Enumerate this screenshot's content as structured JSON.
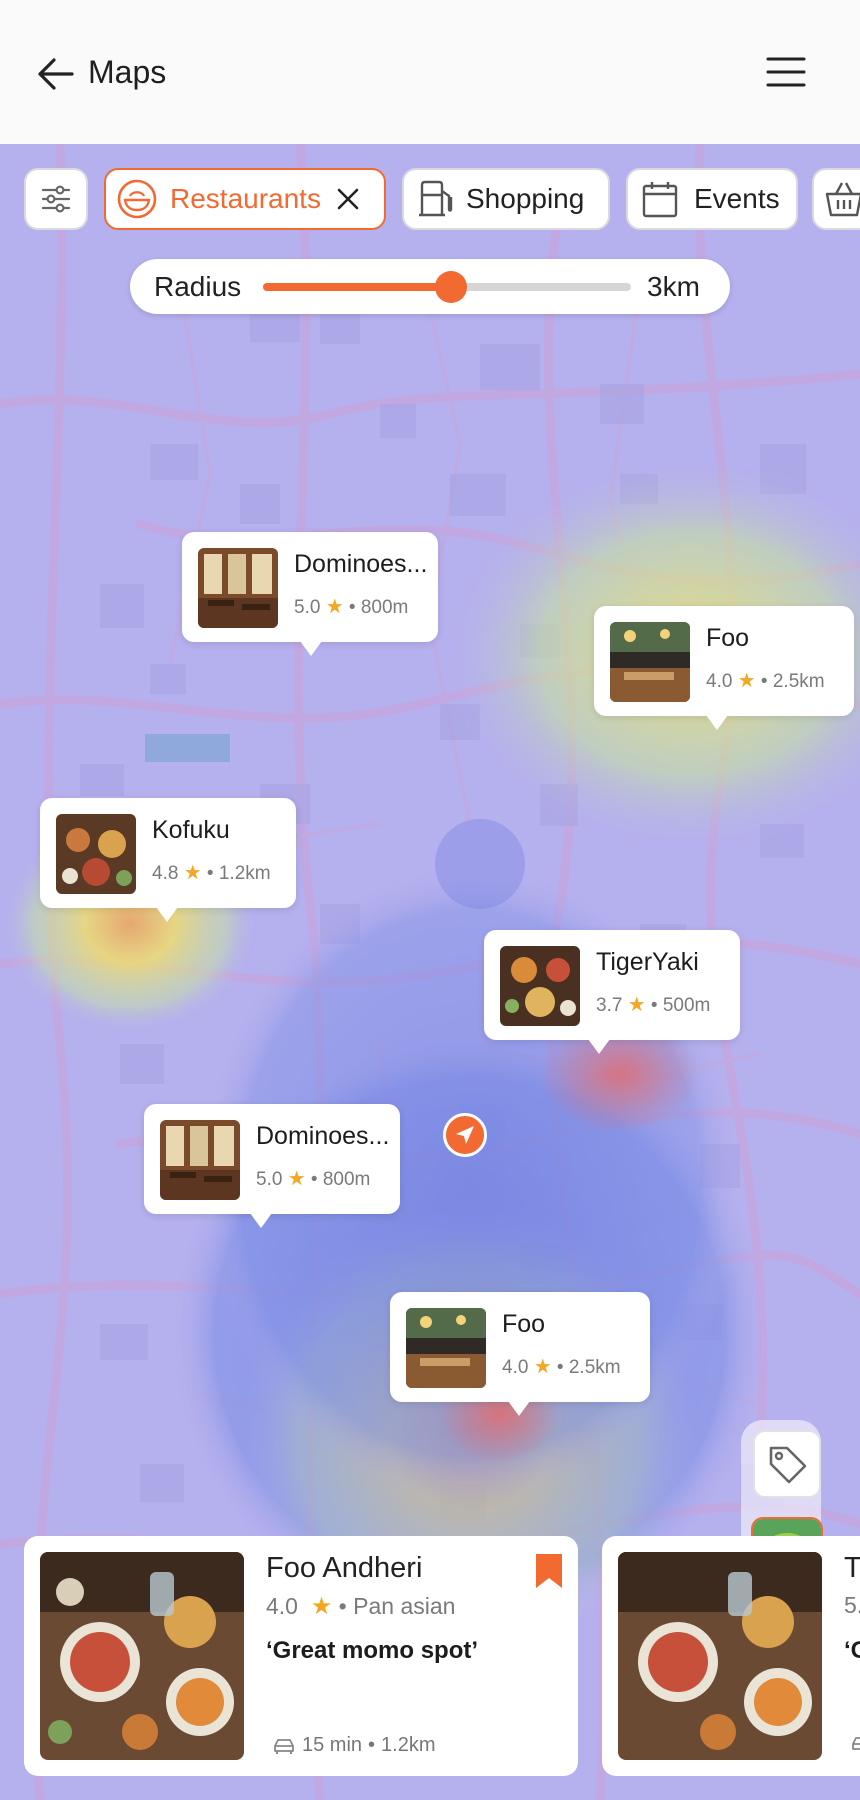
{
  "header": {
    "title": "Maps",
    "back_icon": "arrow-left-icon",
    "menu_icon": "hamburger-menu-icon"
  },
  "filters": {
    "settings_icon": "sliders-icon",
    "chips": [
      {
        "label": "Restaurants",
        "icon": "food-bowl-icon",
        "active": true,
        "close_icon": "close-icon"
      },
      {
        "label": "Shopping",
        "icon": "gas-pump-icon",
        "active": false
      },
      {
        "label": "Events",
        "icon": "calendar-icon",
        "active": false
      },
      {
        "label": "",
        "icon": "basket-icon",
        "active": false
      }
    ]
  },
  "radius": {
    "label": "Radius",
    "value": "3km",
    "fraction": 0.51
  },
  "markers": [
    {
      "name": "Dominoes...",
      "rating": "5.0",
      "distance": "800m"
    },
    {
      "name": "Foo",
      "rating": "4.0",
      "distance": "2.5km"
    },
    {
      "name": "Kofuku",
      "rating": "4.8",
      "distance": "1.2km"
    },
    {
      "name": "TigerYaki",
      "rating": "3.7",
      "distance": "500m"
    },
    {
      "name": "Dominoes...",
      "rating": "5.0",
      "distance": "800m"
    },
    {
      "name": "Foo",
      "rating": "4.0",
      "distance": "2.5km"
    }
  ],
  "separator": "•",
  "star": "★",
  "cards": [
    {
      "name": "Foo Andheri",
      "rating": "4.0",
      "cuisine": "Pan asian",
      "quote": "‘Great momo spot’",
      "time": "15 min",
      "distance": "1.2km"
    },
    {
      "name": "T",
      "rating": "5.",
      "cuisine": "",
      "quote": "‘G",
      "time": "",
      "distance": ""
    }
  ],
  "colors": {
    "accent": "#f26a32",
    "map_bg": "#b5b0ee",
    "star": "#f5a623"
  }
}
